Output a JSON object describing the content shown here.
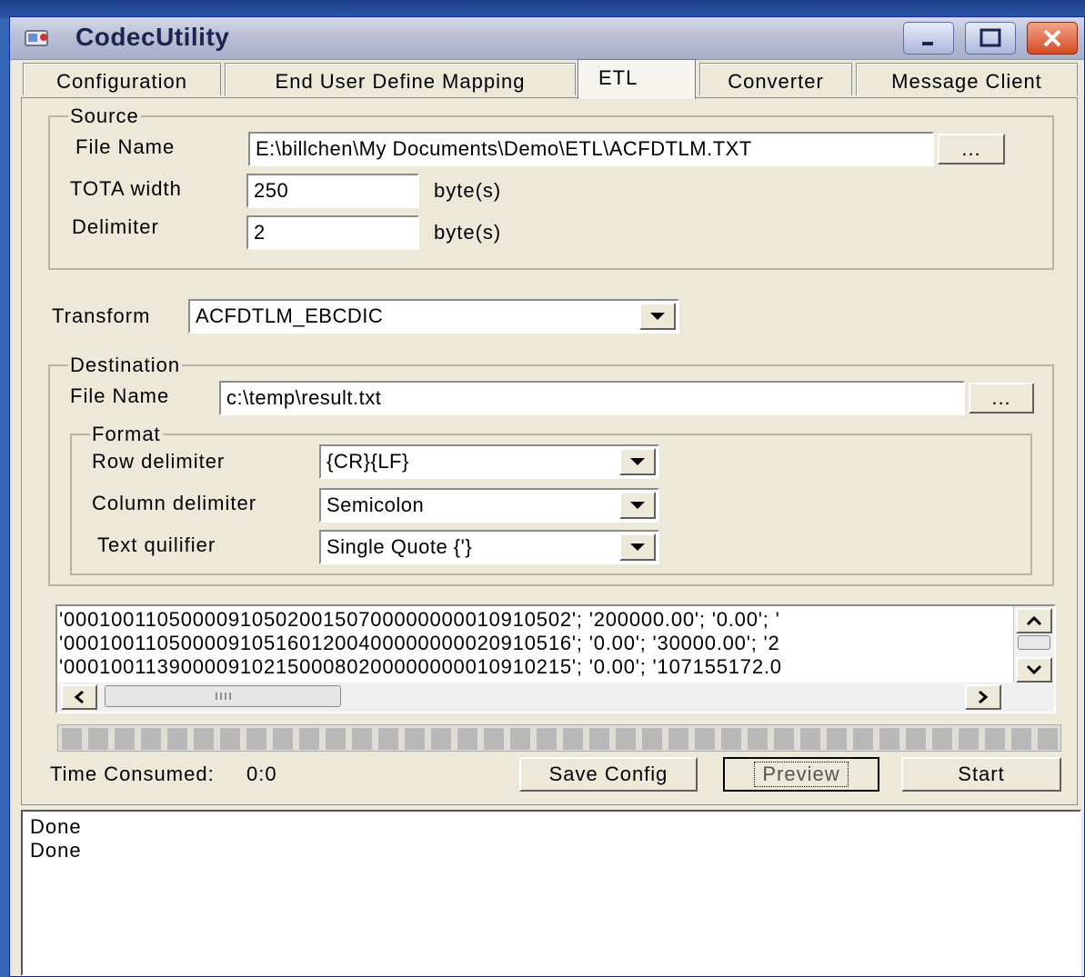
{
  "window": {
    "title": "CodecUtility",
    "icon": "app-icon",
    "controls": {
      "minimize": "minimize-icon",
      "maximize": "maximize-icon",
      "close": "close-icon"
    }
  },
  "tabs": [
    {
      "label": "Configuration",
      "active": false
    },
    {
      "label": "End User Define Mapping",
      "active": false
    },
    {
      "label": "ETL",
      "active": true
    },
    {
      "label": "Converter",
      "active": false
    },
    {
      "label": "Message Client",
      "active": false
    }
  ],
  "source": {
    "legend": "Source",
    "file_name_label": "File Name",
    "file_name_value": "E:\\billchen\\My Documents\\Demo\\ETL\\ACFDTLM.TXT",
    "browse_label": "...",
    "tota_width_label": "TOTA width",
    "tota_width_value": "250",
    "tota_width_unit": "byte(s)",
    "delimiter_label": "Delimiter",
    "delimiter_value": "2",
    "delimiter_unit": "byte(s)"
  },
  "transform": {
    "label": "Transform",
    "selected": "ACFDTLM_EBCDIC"
  },
  "destination": {
    "legend": "Destination",
    "file_name_label": "File Name",
    "file_name_value": "c:\\temp\\result.txt",
    "browse_label": "...",
    "format": {
      "legend": "Format",
      "row_delimiter_label": "Row delimiter",
      "row_delimiter_value": "{CR}{LF}",
      "column_delimiter_label": "Column delimiter",
      "column_delimiter_value": "Semicolon",
      "text_qualifier_label": "Text quilifier",
      "text_qualifier_value": "Single Quote {'}"
    }
  },
  "preview_lines": [
    "'0001001105000091050200150700000000010910502'; '200000.00'; '0.00'; '",
    "'0001001105000091051601200400000000020910516'; '0.00'; '30000.00'; '2",
    "'0001001139000091021500080200000000010910215'; '0.00'; '107155172.0"
  ],
  "progress": {
    "fraction": 0.0
  },
  "footer": {
    "time_consumed_label": "Time Consumed:",
    "time_consumed_value": "0:0",
    "save_config_label": "Save Config",
    "preview_label": "Preview",
    "start_label": "Start"
  },
  "log_lines": [
    "Done",
    "Done"
  ]
}
